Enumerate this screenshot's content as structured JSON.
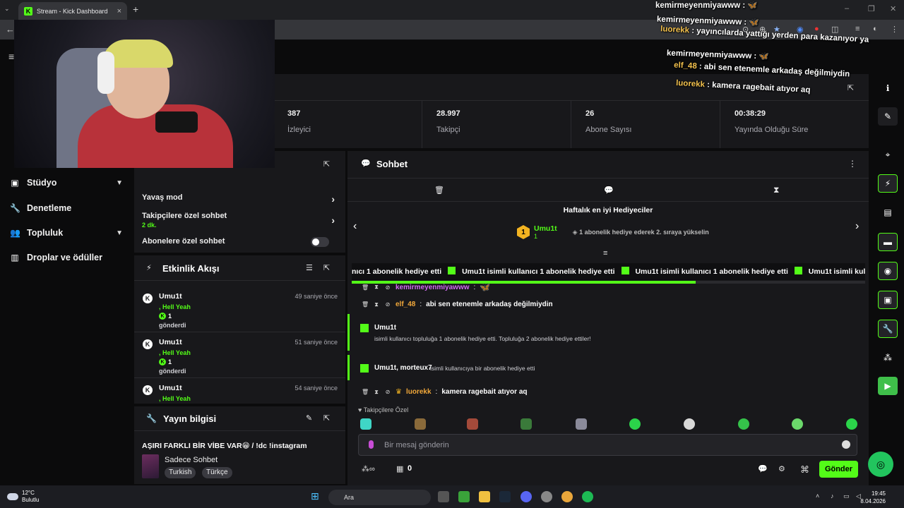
{
  "browser": {
    "tab_title": "Stream - Kick Dashboard",
    "tab_favicon": "K"
  },
  "sidebar": {
    "items": [
      {
        "label": "Stüdyo",
        "icon": "studio-icon",
        "has_chevron": true
      },
      {
        "label": "Denetleme",
        "icon": "wrench-icon",
        "has_chevron": false
      },
      {
        "label": "Topluluk",
        "icon": "community-icon",
        "has_chevron": true
      },
      {
        "label": "Droplar ve ödüller",
        "icon": "drops-icon",
        "has_chevron": false
      }
    ]
  },
  "stats": [
    {
      "value": "387",
      "label": "İzleyici"
    },
    {
      "value": "28.997",
      "label": "Takipçi"
    },
    {
      "value": "26",
      "label": "Abone Sayısı"
    },
    {
      "value": "00:38:29",
      "label": "Yayında Olduğu Süre"
    }
  ],
  "moderation": {
    "slow_mode": "Yavaş mod",
    "followers_only": "Takipçilere özel sohbet",
    "followers_only_value": "2 dk.",
    "subscribers_only": "Abonelere özel sohbet"
  },
  "activity": {
    "title": "Etkinlik Akışı",
    "items": [
      {
        "user": "Umu1t",
        "time": "49 saniye önce",
        "message": ", Hell Yeah",
        "amount": "1",
        "action": "gönderdi"
      },
      {
        "user": "Umu1t",
        "time": "51 saniye önce",
        "message": ", Hell Yeah",
        "amount": "1",
        "action": "gönderdi"
      },
      {
        "user": "Umu1t",
        "time": "54 saniye önce",
        "message": ", Hell Yeah",
        "amount": "",
        "action": ""
      }
    ]
  },
  "stream_info": {
    "title": "Yayın bilgisi",
    "stream_title": "AŞIRI FARKLI BİR VİBE VAR😁 / !dc !instagram",
    "category": "Sadece Sohbet",
    "tags": [
      "Turkish",
      "Türkçe"
    ]
  },
  "chat": {
    "title": "Sohbet",
    "gifters_title": "Haftalık en iyi Hediyeciler",
    "top_gifter": {
      "rank": "1",
      "name": "Umu1t",
      "count": "1"
    },
    "gifter_hint": "1 abonelik hediye ederek 2. sıraya yükselin",
    "marquee": [
      {
        "pre": "nıcı",
        "amount": "1",
        "post": "abonelik hediye etti"
      },
      {
        "name": "Umu1t",
        "pre": "isimli kullanıcı",
        "amount": "1",
        "post": "abonelik hediye etti"
      },
      {
        "name": "Umu1t",
        "pre": "isimli kullanıcı",
        "amount": "1",
        "post": "abonelik hediye etti"
      },
      {
        "name": "Umu1t",
        "pre": "isimli kullanı",
        "amount": "",
        "post": ""
      }
    ],
    "progress_percent": 67,
    "messages": [
      {
        "user": "kemirmeyenmiyawww",
        "text": "",
        "color": "#d36cf3"
      },
      {
        "user": "elf_48",
        "text": "abi sen etenemle arkadaş değilmiydin",
        "color": "#f2a83a"
      },
      {
        "user": "luorekk",
        "text": "kamera ragebait atıyor aq",
        "color": "#f2a83a"
      }
    ],
    "sub_event_1": {
      "name": "Umu1t",
      "text": "isimli kullanıcı topluluğa 1 abonelik hediye etti. Topluluğa 2 abonelik hediye ettiler!"
    },
    "sub_event_2": {
      "names": "Umu1t, morteux7",
      "text": "isimli kullanıcıya bir abonelik hediye etti"
    },
    "followers_only_label": "Takipçilere Özel",
    "input_placeholder": "Bir mesaj gönderin",
    "points": "0",
    "send_label": "Gönder"
  },
  "overlay_chat": [
    {
      "user": "kemirmeyenmiyawww",
      "text": "🦋",
      "gold": false
    },
    {
      "user": "kemirmeyenmiyawww",
      "text": "🦋",
      "gold": false
    },
    {
      "user": "luorekk",
      "text": "yayıncılarda yattığı yerden para kazanıyor ya",
      "gold": true
    },
    {
      "user": "kemirmeyenmiyawww",
      "text": "🦋",
      "gold": false
    },
    {
      "user": "elf_48",
      "text": "abi sen etenemle arkadaş değilmiydin",
      "gold": true
    },
    {
      "user": "luorekk",
      "text": "kamera ragebait atıyor aq",
      "gold": true
    }
  ],
  "taskbar": {
    "temperature": "12°C",
    "weather": "Bulutlu",
    "search": "Ara",
    "time": "19:45",
    "date": "8.04.2026"
  },
  "colors": {
    "accent": "#53fc18",
    "panel": "#18181b",
    "background": "#0b0b0c"
  }
}
